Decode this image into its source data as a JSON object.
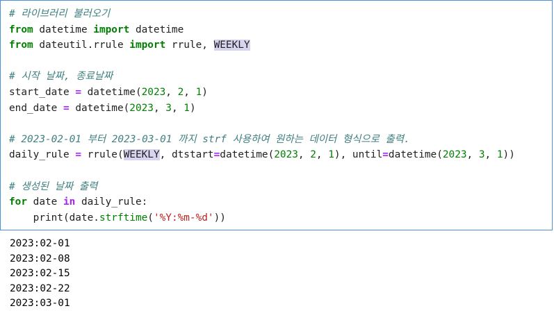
{
  "code_lines": [
    [
      {
        "t": "# 라이브러리 불러오기",
        "c": "cm"
      }
    ],
    [
      {
        "t": "from",
        "c": "kw"
      },
      {
        "t": " datetime ",
        "c": ""
      },
      {
        "t": "import",
        "c": "kw"
      },
      {
        "t": " datetime",
        "c": ""
      }
    ],
    [
      {
        "t": "from",
        "c": "kw"
      },
      {
        "t": " dateutil.rrule ",
        "c": ""
      },
      {
        "t": "import",
        "c": "kw"
      },
      {
        "t": " rrule, ",
        "c": ""
      },
      {
        "t": "WEEKLY",
        "c": "hl"
      }
    ],
    [],
    [
      {
        "t": "# 시작 날짜, 종료날짜",
        "c": "cm"
      }
    ],
    [
      {
        "t": "start_date ",
        "c": ""
      },
      {
        "t": "=",
        "c": "op"
      },
      {
        "t": " datetime(",
        "c": ""
      },
      {
        "t": "2023",
        "c": "num"
      },
      {
        "t": ", ",
        "c": ""
      },
      {
        "t": "2",
        "c": "num"
      },
      {
        "t": ", ",
        "c": ""
      },
      {
        "t": "1",
        "c": "num"
      },
      {
        "t": ")",
        "c": ""
      }
    ],
    [
      {
        "t": "end_date ",
        "c": ""
      },
      {
        "t": "=",
        "c": "op"
      },
      {
        "t": " datetime(",
        "c": ""
      },
      {
        "t": "2023",
        "c": "num"
      },
      {
        "t": ", ",
        "c": ""
      },
      {
        "t": "3",
        "c": "num"
      },
      {
        "t": ", ",
        "c": ""
      },
      {
        "t": "1",
        "c": "num"
      },
      {
        "t": ")",
        "c": ""
      }
    ],
    [],
    [
      {
        "t": "# 2023-02-01 부터 2023-03-01 까지 strf 사용하여 원하는 데이터 형식으로 출력.",
        "c": "cm"
      }
    ],
    [
      {
        "t": "daily_rule ",
        "c": ""
      },
      {
        "t": "=",
        "c": "op"
      },
      {
        "t": " rrule(",
        "c": ""
      },
      {
        "t": "WEEKLY",
        "c": "hl"
      },
      {
        "t": ", dtstart",
        "c": ""
      },
      {
        "t": "=",
        "c": "op"
      },
      {
        "t": "datetime(",
        "c": ""
      },
      {
        "t": "2023",
        "c": "num"
      },
      {
        "t": ", ",
        "c": ""
      },
      {
        "t": "2",
        "c": "num"
      },
      {
        "t": ", ",
        "c": ""
      },
      {
        "t": "1",
        "c": "num"
      },
      {
        "t": "), until",
        "c": ""
      },
      {
        "t": "=",
        "c": "op"
      },
      {
        "t": "datetime(",
        "c": ""
      },
      {
        "t": "2023",
        "c": "num"
      },
      {
        "t": ", ",
        "c": ""
      },
      {
        "t": "3",
        "c": "num"
      },
      {
        "t": ", ",
        "c": ""
      },
      {
        "t": "1",
        "c": "num"
      },
      {
        "t": "))",
        "c": ""
      }
    ],
    [],
    [
      {
        "t": "# 생성된 날짜 출력",
        "c": "cm"
      }
    ],
    [
      {
        "t": "for",
        "c": "kw"
      },
      {
        "t": " date ",
        "c": ""
      },
      {
        "t": "in",
        "c": "op"
      },
      {
        "t": " daily_rule:",
        "c": ""
      }
    ],
    [
      {
        "t": "    print(date.",
        "c": ""
      },
      {
        "t": "strftime",
        "c": "bi"
      },
      {
        "t": "(",
        "c": ""
      },
      {
        "t": "'%Y:%m-%d'",
        "c": "str"
      },
      {
        "t": "))",
        "c": ""
      }
    ]
  ],
  "output_lines": [
    "2023:02-01",
    "2023:02-08",
    "2023:02-15",
    "2023:02-22",
    "2023:03-01"
  ]
}
